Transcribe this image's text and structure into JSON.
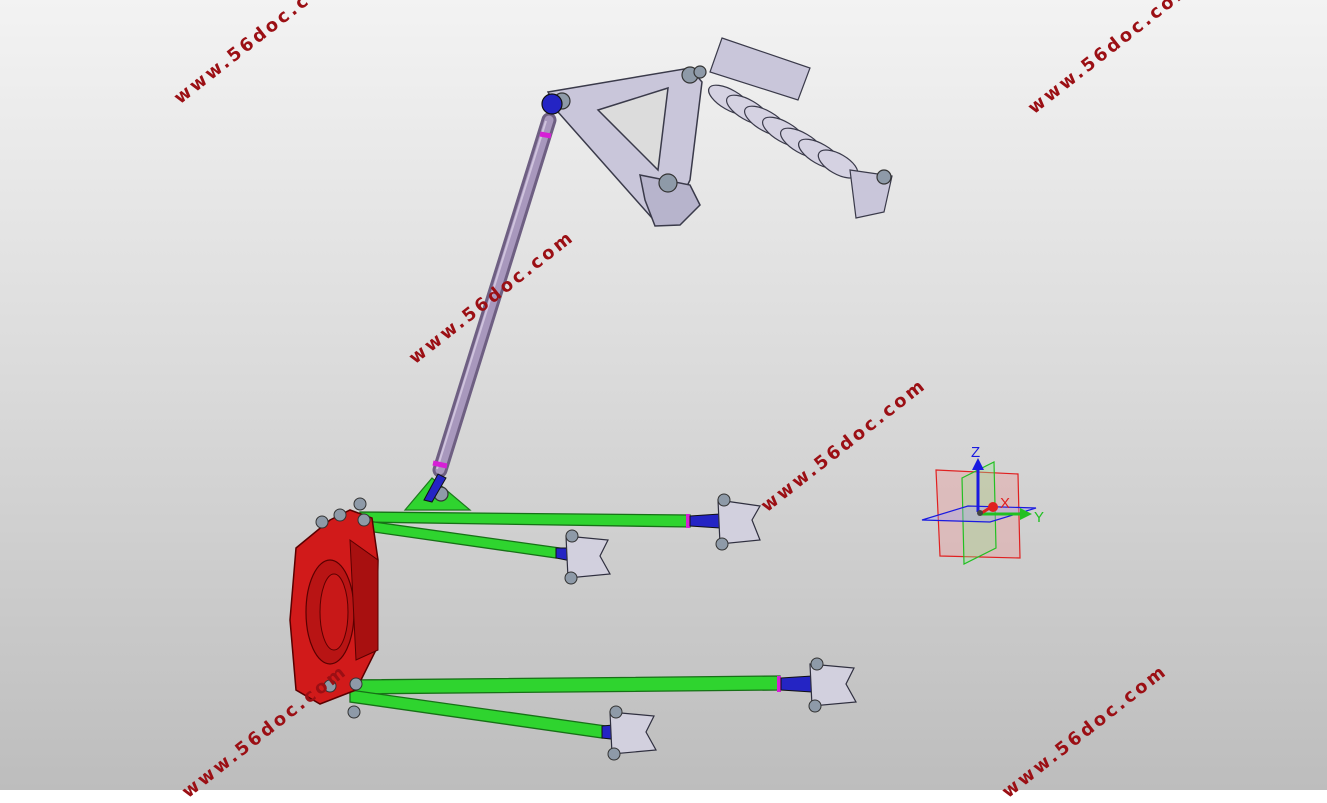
{
  "watermark": {
    "text": "www.56doc.com",
    "color": "#9b0f14"
  },
  "triad": {
    "x_label": "X",
    "y_label": "Y",
    "z_label": "Z",
    "x_color": "#e02020",
    "y_color": "#22c022",
    "z_color": "#1a1ae0"
  },
  "colors": {
    "upright": "#d11a1a",
    "control_arms": "#2fd42f",
    "pushrod": "#9a88b0",
    "rocker_and_damper": "#c9c6da",
    "rod_ends": "#1f1fc0"
  }
}
